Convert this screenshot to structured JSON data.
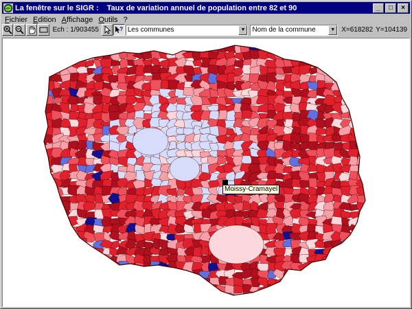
{
  "window": {
    "title": "La fenêtre sur le SIGR :",
    "subtitle": "Taux de variation annuel de population entre 82 et 90",
    "controls": {
      "minimize": "_",
      "maximize": "□",
      "close": "×"
    }
  },
  "menu": {
    "items": [
      {
        "label": "Fichier"
      },
      {
        "label": "Edition"
      },
      {
        "label": "Affichage"
      },
      {
        "label": "Outils"
      },
      {
        "label": "?"
      }
    ]
  },
  "toolbar": {
    "tools": [
      "zoom-in-icon",
      "zoom-out-icon",
      "pan-hand-icon",
      "rectangle-select-icon"
    ],
    "scale": "Ech : 1/903455",
    "layer_select": "Les communes",
    "field_select": "Nom de la commune",
    "coord_x": "X=618282",
    "coord_y": "Y=104139"
  },
  "map": {
    "tooltip": "Moissy-Cramayel",
    "palette": {
      "dark_red": "#b0101e",
      "red": "#e0202c",
      "medium_red": "#f0505c",
      "light_red": "#f8a0a8",
      "pale_pink": "#fcd8dc",
      "pale_blue": "#d8dcfc",
      "blue": "#6070e0",
      "dark_blue": "#101090",
      "boundary": "#400000"
    }
  }
}
